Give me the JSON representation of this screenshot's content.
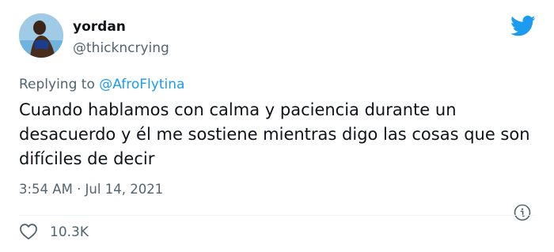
{
  "author": {
    "display_name": "yordan",
    "handle": "@thickncrying"
  },
  "reply": {
    "prefix": "Replying to ",
    "mention": "@AfroFlytina"
  },
  "tweet": {
    "text": "Cuando hablamos con calma y paciencia durante un desacuerdo y él me sostiene mientras digo las cosas que son difíciles de decir",
    "timestamp": "3:54 AM · Jul 14, 2021"
  },
  "engagement": {
    "likes": "10.3K"
  },
  "icons": {
    "brand": "twitter-bird-icon",
    "info": "info-icon",
    "like": "heart-icon"
  },
  "colors": {
    "brand": "#1d9bf0",
    "mention": "#1d9bf0",
    "secondary_text": "#536471",
    "primary_text": "#0f1419"
  }
}
